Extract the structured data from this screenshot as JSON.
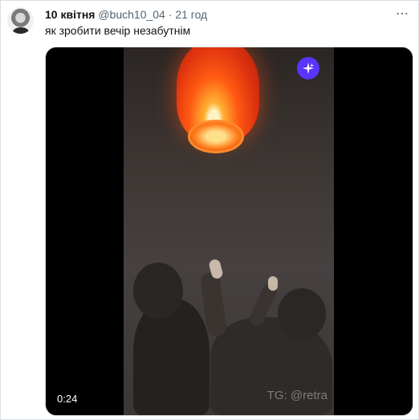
{
  "tweet": {
    "display_name": "10 квітня",
    "handle": "@buch10_04",
    "separator": "·",
    "time_ago": "21 год",
    "more_icon": "more-icon",
    "text": "як зробити вечір незабутнім"
  },
  "media": {
    "duration": "0:24",
    "watermark": "TG: @retra",
    "sparkle_icon": "sparkle-icon",
    "accent_color": "#5a34ff"
  }
}
